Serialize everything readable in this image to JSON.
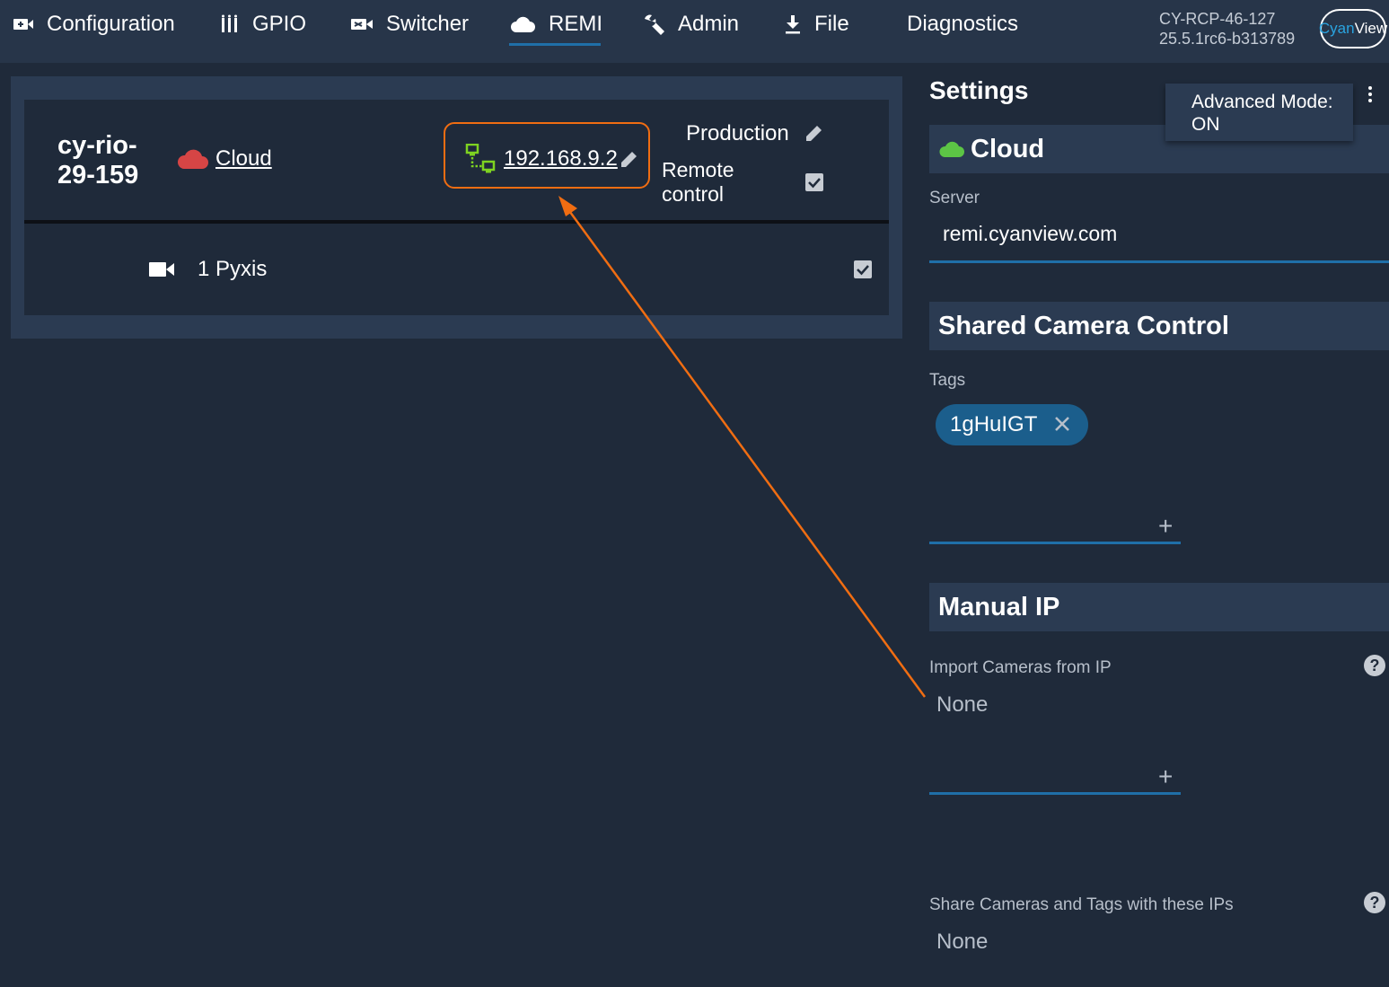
{
  "nav": {
    "items": [
      {
        "label": "Configuration",
        "icon": "video-settings-icon"
      },
      {
        "label": "GPIO",
        "icon": "gpio-icon"
      },
      {
        "label": "Switcher",
        "icon": "switcher-icon"
      },
      {
        "label": "REMI",
        "icon": "cloud-icon",
        "active": true
      },
      {
        "label": "Admin",
        "icon": "wrench-icon"
      },
      {
        "label": "File",
        "icon": "download-icon"
      },
      {
        "label": "Diagnostics",
        "icon": ""
      }
    ],
    "device_id": "CY-RCP-46-127",
    "version": "25.5.1rc6-b313789",
    "brand_part1": "Cyan",
    "brand_part2": "View"
  },
  "node": {
    "name_line1": "cy-rio-",
    "name_line2": "29-159",
    "cloud_label": "Cloud",
    "ip": "192.168.9.2",
    "production_label": "Production",
    "remote_label_line1": "Remote",
    "remote_label_line2": "control",
    "remote_checked": true,
    "camera_label": "1 Pyxis",
    "camera_checked": true
  },
  "settings": {
    "title": "Settings",
    "advanced_mode_line1": "Advanced Mode:",
    "advanced_mode_line2": "ON",
    "cloud": {
      "title": "Cloud",
      "server_label": "Server",
      "server_value": "remi.cyanview.com"
    },
    "shared": {
      "title": "Shared Camera Control",
      "tags_label": "Tags",
      "tags": [
        "1gHuIGT"
      ]
    },
    "manual_ip": {
      "title": "Manual IP",
      "import_label": "Import Cameras from IP",
      "import_value": "None",
      "share_label": "Share Cameras and Tags with these IPs",
      "share_value": "None"
    }
  },
  "colors": {
    "background": "#1f2a3a",
    "panel": "#2b3b52",
    "accent_blue": "#1f6fa8",
    "highlight_orange": "#f06d12",
    "cloud_red": "#d64545",
    "cloud_green": "#5cc545",
    "network_green": "#7ed321"
  }
}
